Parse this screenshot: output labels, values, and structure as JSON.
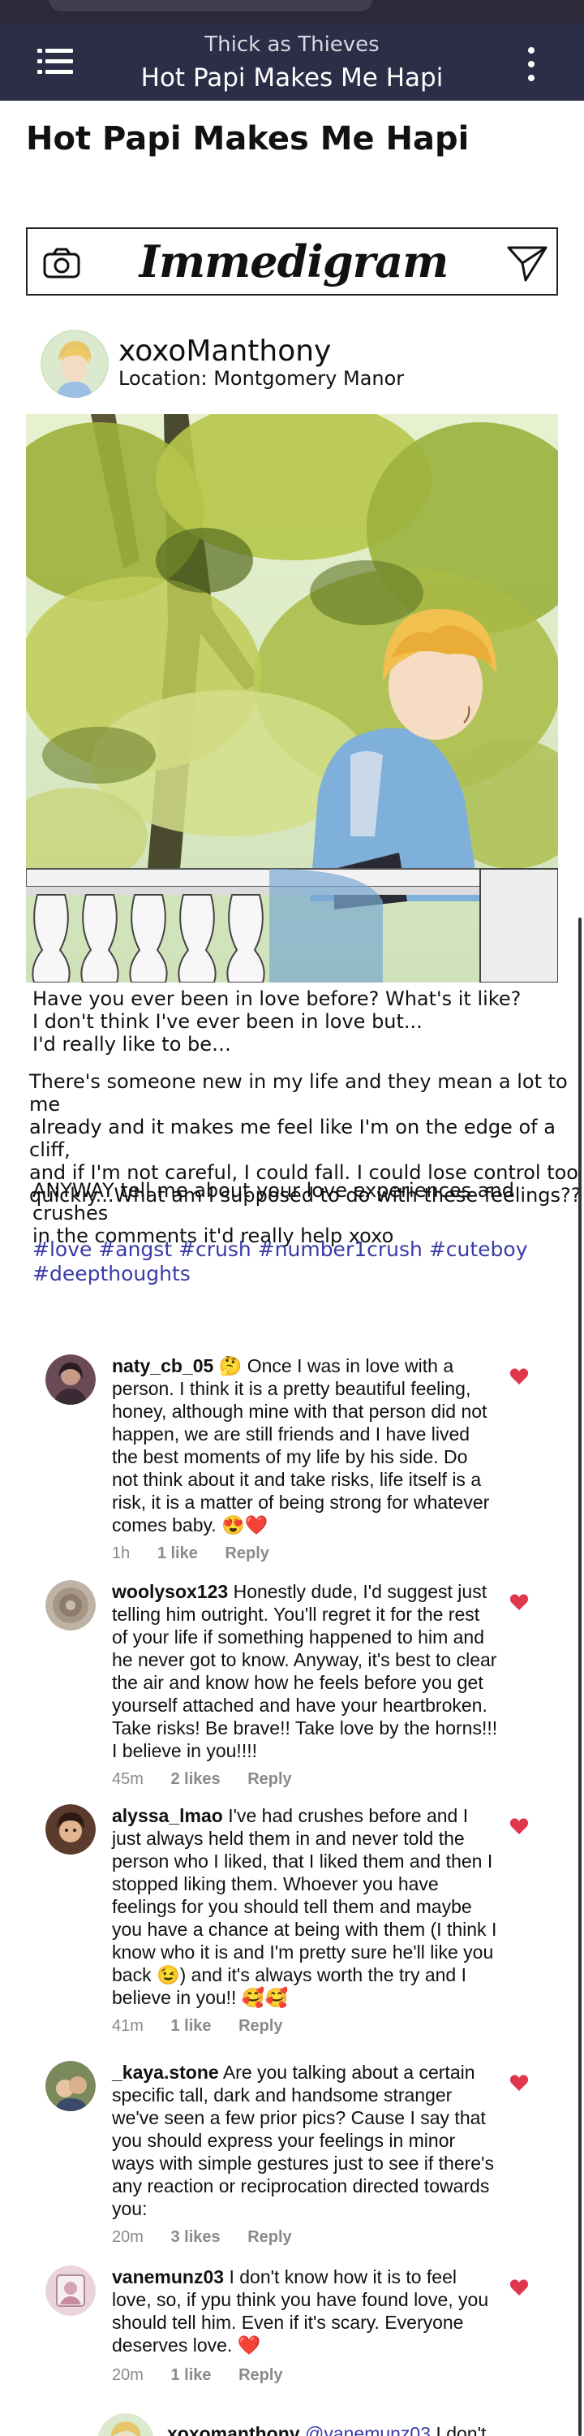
{
  "status": {
    "pill": ""
  },
  "header": {
    "story_title": "Thick as Thieves",
    "chapter_title": "Hot Papi Makes Me Hapi",
    "menu_icon": "hamburger-menu-icon",
    "more_icon": "vertical-dots-icon"
  },
  "page": {
    "title": "Hot Papi Makes Me Hapi"
  },
  "insta_bar": {
    "logo": "Immedigram",
    "camera_icon": "camera-icon",
    "send_icon": "send-paper-plane-icon"
  },
  "post": {
    "username": "xoxoManthony",
    "location": "Location: Montgomery Manor",
    "caption_1": "Have you ever been in love before? What's it like?\nI don't think I've ever been in love but...\nI'd really like to be…",
    "caption_2": "There's someone new in my life and they mean a lot to me\n already and it makes me feel like I'm on the edge of a cliff,\n and if I'm not careful, I could fall. I could lose control too\n quickly...What am I supposed to do with these feelings??",
    "caption_3": "ANYWAY tell me about your love experiences and crushes\n in the comments it'd really help xoxo",
    "hashtags": "#love #angst #crush #number1crush #cuteboy\n #deepthoughts"
  },
  "comments": [
    {
      "user": "naty_cb_05",
      "text": " 🤔 Once I was in love with a person. I think it is a pretty beautiful feeling, honey, although mine with that person did not happen, we are still friends and I have lived the best moments of my life by his side. Do not think about it and take risks, life itself is a risk, it is a matter of being strong for whatever comes baby. 😍❤️",
      "time": "1h",
      "likes": "1 like",
      "reply": "Reply"
    },
    {
      "user": "woolysox123",
      "text": " Honestly dude, I'd suggest just telling him outright.  You'll regret it for the rest of your life if something happened to him and he never got to know.  Anyway, it's best to clear the air and know how he feels before you get yourself attached and have your heartbroken.  Take risks!  Be brave!! Take love by the horns!!! I believe in you!!!!",
      "time": "45m",
      "likes": "2 likes",
      "reply": "Reply"
    },
    {
      "user": "alyssa_lmao",
      "text": " I've had crushes before and I just always held them in and never told the person who I liked, that I liked them and then I stopped liking them. Whoever you have feelings for you should tell them and maybe you have a chance at being with them (I think I know who it is and I'm pretty sure he'll like you back 😉) and it's always worth the try and I believe in you!! 🥰🥰",
      "time": "41m",
      "likes": "1 like",
      "reply": "Reply"
    },
    {
      "user": "_kaya.stone",
      "text": " Are you talking about a certain specific tall, dark and handsome stranger we've seen a few prior pics? Cause I say that you should express your feelings in minor ways with simple gestures just to see if there's any reaction or reciprocation directed towards you:",
      "time": "20m",
      "likes": "3 likes",
      "reply": "Reply"
    },
    {
      "user": "vanemunz03",
      "text": " I don't know how it is to feel love, so, if ypu think you have found love, you should tell him. Even if it's scary. Everyone deserves love. ❤️",
      "time": "20m",
      "likes": "1 like",
      "reply": "Reply"
    }
  ],
  "last_comment": {
    "user": "xoxomanthony",
    "mention": "@vanemunz03",
    "text": " I don't"
  },
  "colors": {
    "header_bg": "#2c2d47",
    "hashtag": "#3a3aa8",
    "heart": "#e0374d"
  }
}
